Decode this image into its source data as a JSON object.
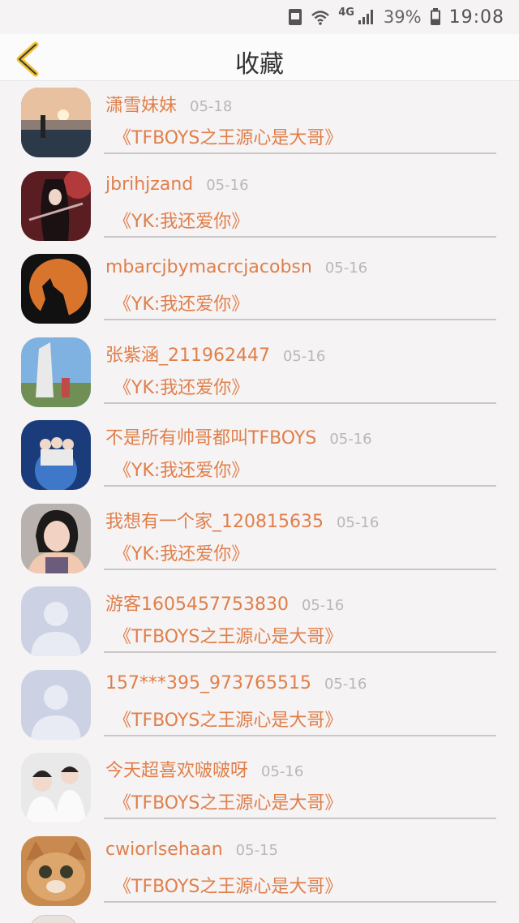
{
  "status_bar": {
    "network": "4G",
    "battery": "39%",
    "time": "19:08"
  },
  "header": {
    "title": "收藏"
  },
  "items": [
    {
      "name": "潇雪妹妹",
      "date": "05-18",
      "title": "《TFBOYS之王源心是大哥》",
      "avatar": "sunset-photo-avatar"
    },
    {
      "name": "jbrihjzand",
      "date": "05-16",
      "title": "《YK:我还爱你》",
      "avatar": "anime-girl-avatar"
    },
    {
      "name": "mbarcjbymacrcjacobsn",
      "date": "05-16",
      "title": "《YK:我还爱你》",
      "avatar": "howling-wolf-avatar"
    },
    {
      "name": "张紫涵_211962447",
      "date": "05-16",
      "title": "《YK:我还爱你》",
      "avatar": "landmark-photo-avatar"
    },
    {
      "name": "不是所有帅哥都叫TFBOYS",
      "date": "05-16",
      "title": "《YK:我还爱你》",
      "avatar": "band-stage-avatar"
    },
    {
      "name": "我想有一个家_120815635",
      "date": "05-16",
      "title": "《YK:我还爱你》",
      "avatar": "girl-photo-avatar"
    },
    {
      "name": "游客1605457753830",
      "date": "05-16",
      "title": "《TFBOYS之王源心是大哥》",
      "avatar": "default-user-avatar"
    },
    {
      "name": "157***395_973765515",
      "date": "05-16",
      "title": "《TFBOYS之王源心是大哥》",
      "avatar": "default-user-avatar"
    },
    {
      "name": "今天超喜欢啵啵呀",
      "date": "05-16",
      "title": "《TFBOYS之王源心是大哥》",
      "avatar": "boys-photo-avatar"
    },
    {
      "name": "cwiorlsehaan",
      "date": "05-15",
      "title": "《TFBOYS之王源心是大哥》",
      "avatar": "cat-face-avatar"
    }
  ],
  "colors": {
    "accent": "#e07f4a",
    "back_arrow": "#f1c232",
    "date": "#b8b8b8"
  }
}
